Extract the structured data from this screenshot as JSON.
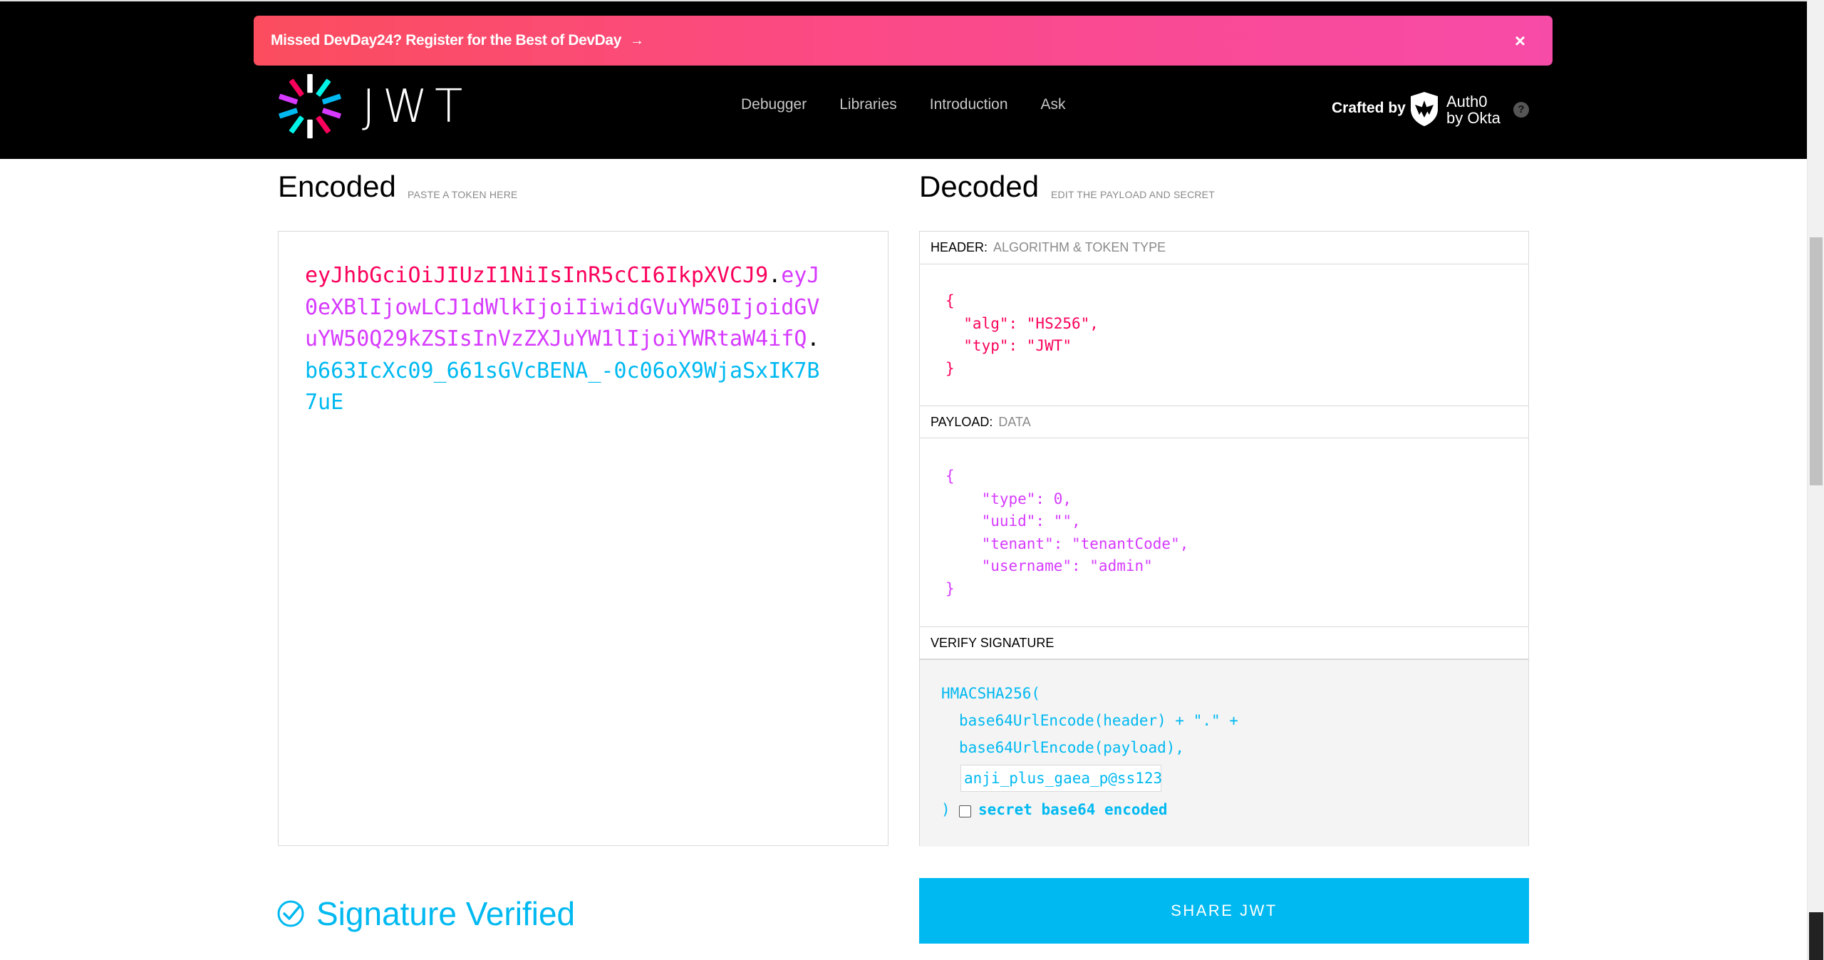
{
  "banner": {
    "text": "Missed DevDay24? Register for the Best of DevDay",
    "arrow": "→",
    "close": "×"
  },
  "brand": {
    "logo_word": "JWT",
    "logo_icon": "jwt-flower-icon"
  },
  "nav": {
    "items": [
      "Debugger",
      "Libraries",
      "Introduction",
      "Ask"
    ]
  },
  "crafted": {
    "label": "Crafted by",
    "company_line1": "Auth0",
    "company_line2": "by Okta",
    "help": "?"
  },
  "encoded": {
    "title": "Encoded",
    "subtitle": "PASTE A TOKEN HERE",
    "header_part": "eyJhbGciOiJIUzI1NiIsInR5cCI6IkpXVCJ9",
    "payload_part": "eyJ0eXBlIjowLCJ1dWlkIjoiIiwidGVuYW50IjoidGVuYW50Q29kZSIsInVzZXJuYW1lIjoiYWRtaW4ifQ",
    "signature_part": "b663IcXc09_661sGVcBENA_-0c06oX9WjaSxIK7B7uE",
    "dot": "."
  },
  "decoded": {
    "title": "Decoded",
    "subtitle": "EDIT THE PAYLOAD AND SECRET",
    "header_section": {
      "label": "HEADER:",
      "sub": "ALGORITHM & TOKEN TYPE",
      "code": "{\n  \"alg\": \"HS256\",\n  \"typ\": \"JWT\"\n}"
    },
    "payload_section": {
      "label": "PAYLOAD:",
      "sub": "DATA",
      "code": "{\n    \"type\": 0,\n    \"uuid\": \"\",\n    \"tenant\": \"tenantCode\",\n    \"username\": \"admin\"\n}"
    },
    "verify_section": {
      "label": "VERIFY SIGNATURE",
      "fn": "HMACSHA256(",
      "line2": "base64UrlEncode(header) + \".\" +",
      "line3": "base64UrlEncode(payload),",
      "secret_value": "anji_plus_gaea_p@ss123",
      "close": ")",
      "b64_label": "secret base64 encoded"
    }
  },
  "status": {
    "verified_text": "Signature Verified"
  },
  "share": {
    "label": "SHARE JWT"
  },
  "colors": {
    "header": "#fb015b",
    "payload": "#d63aff",
    "signature": "#00b9f1"
  }
}
